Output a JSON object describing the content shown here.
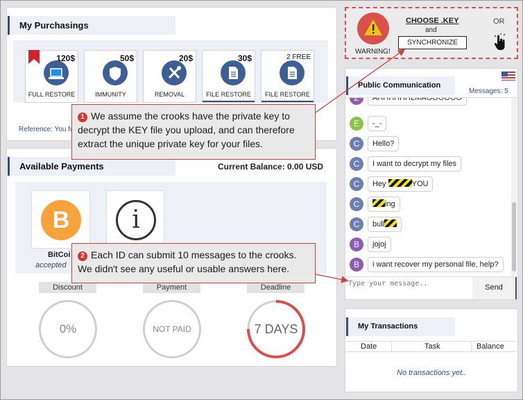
{
  "purchasings": {
    "title": "My Purchasings",
    "items": [
      {
        "price": "120$",
        "label": "FULL RESTORE",
        "icon": "laptop-icon"
      },
      {
        "price": "50$",
        "label": "IMMUNITY",
        "icon": "shield-icon"
      },
      {
        "price": "20$",
        "label": "REMOVAL",
        "icon": "tools-icon"
      },
      {
        "price": "30$",
        "label": "FILE RESTORE",
        "icon": "document-icon"
      },
      {
        "price": "2 FREE",
        "label": "FILE RESTORE",
        "icon": "document-icon"
      }
    ],
    "reference": "Reference: You fu"
  },
  "payments": {
    "title": "Available Payments",
    "balance": "Current Balance: 0.00 USD",
    "bitcoin_name": "BitCoi",
    "bitcoin_sub": "accepted",
    "gauges": [
      {
        "head": "Discount",
        "value": "0%"
      },
      {
        "head": "Payment",
        "value": "NOT PAID"
      },
      {
        "head": "Deadline",
        "value": "7 DAYS",
        "fraction": 0.75
      }
    ]
  },
  "warning": {
    "label": "WARNING!",
    "choose": "CHOOSE .KEY",
    "and": "and",
    "sync": "SYNCHRONIZE",
    "or": "OR"
  },
  "chat": {
    "title": "Public Communication",
    "count": "Messages: 5",
    "partial_message": "AHHHHHHLMAOOOOOO",
    "messages": [
      {
        "avatar": "E",
        "text": "-_-",
        "color": "#8bc34a"
      },
      {
        "avatar": "C",
        "text": "Hello?",
        "color": "#6b7fb3"
      },
      {
        "avatar": "C",
        "text": "I want to decrypt my files",
        "color": "#6b7fb3"
      },
      {
        "avatar": "C",
        "pre": "Hey",
        "post": "YOU",
        "color": "#6b7fb3"
      },
      {
        "avatar": "C",
        "pre": "",
        "post": "ing",
        "color": "#6b7fb3"
      },
      {
        "avatar": "C",
        "pre": "bull",
        "post": "",
        "color": "#6b7fb3"
      },
      {
        "avatar": "B",
        "text": "jojoj",
        "color": "#8e5bb5"
      },
      {
        "avatar": "B",
        "text": "i want recover my personal file, help?",
        "color": "#8e5bb5"
      }
    ],
    "placeholder": "Type your message..",
    "send": "Send"
  },
  "transactions": {
    "title": "My Transactions",
    "cols": [
      "Date",
      "Task",
      "Balance"
    ],
    "empty": "No transactions yet.."
  },
  "callouts": {
    "c1_num": "1",
    "c1_text": "We assume the crooks have the private key to decrypt the KEY file you upload, and can therefore extract the unique private key for your files.",
    "c2_num": "2",
    "c2_text": "Each ID can submit 10 messages to the crooks. We didn't see any useful or usable answers here."
  },
  "colors": {
    "accent": "#2f4f8a",
    "bitcoin": "#f7a23b",
    "warning_red": "#d04040",
    "deadline_arc": "#e04a4a"
  }
}
